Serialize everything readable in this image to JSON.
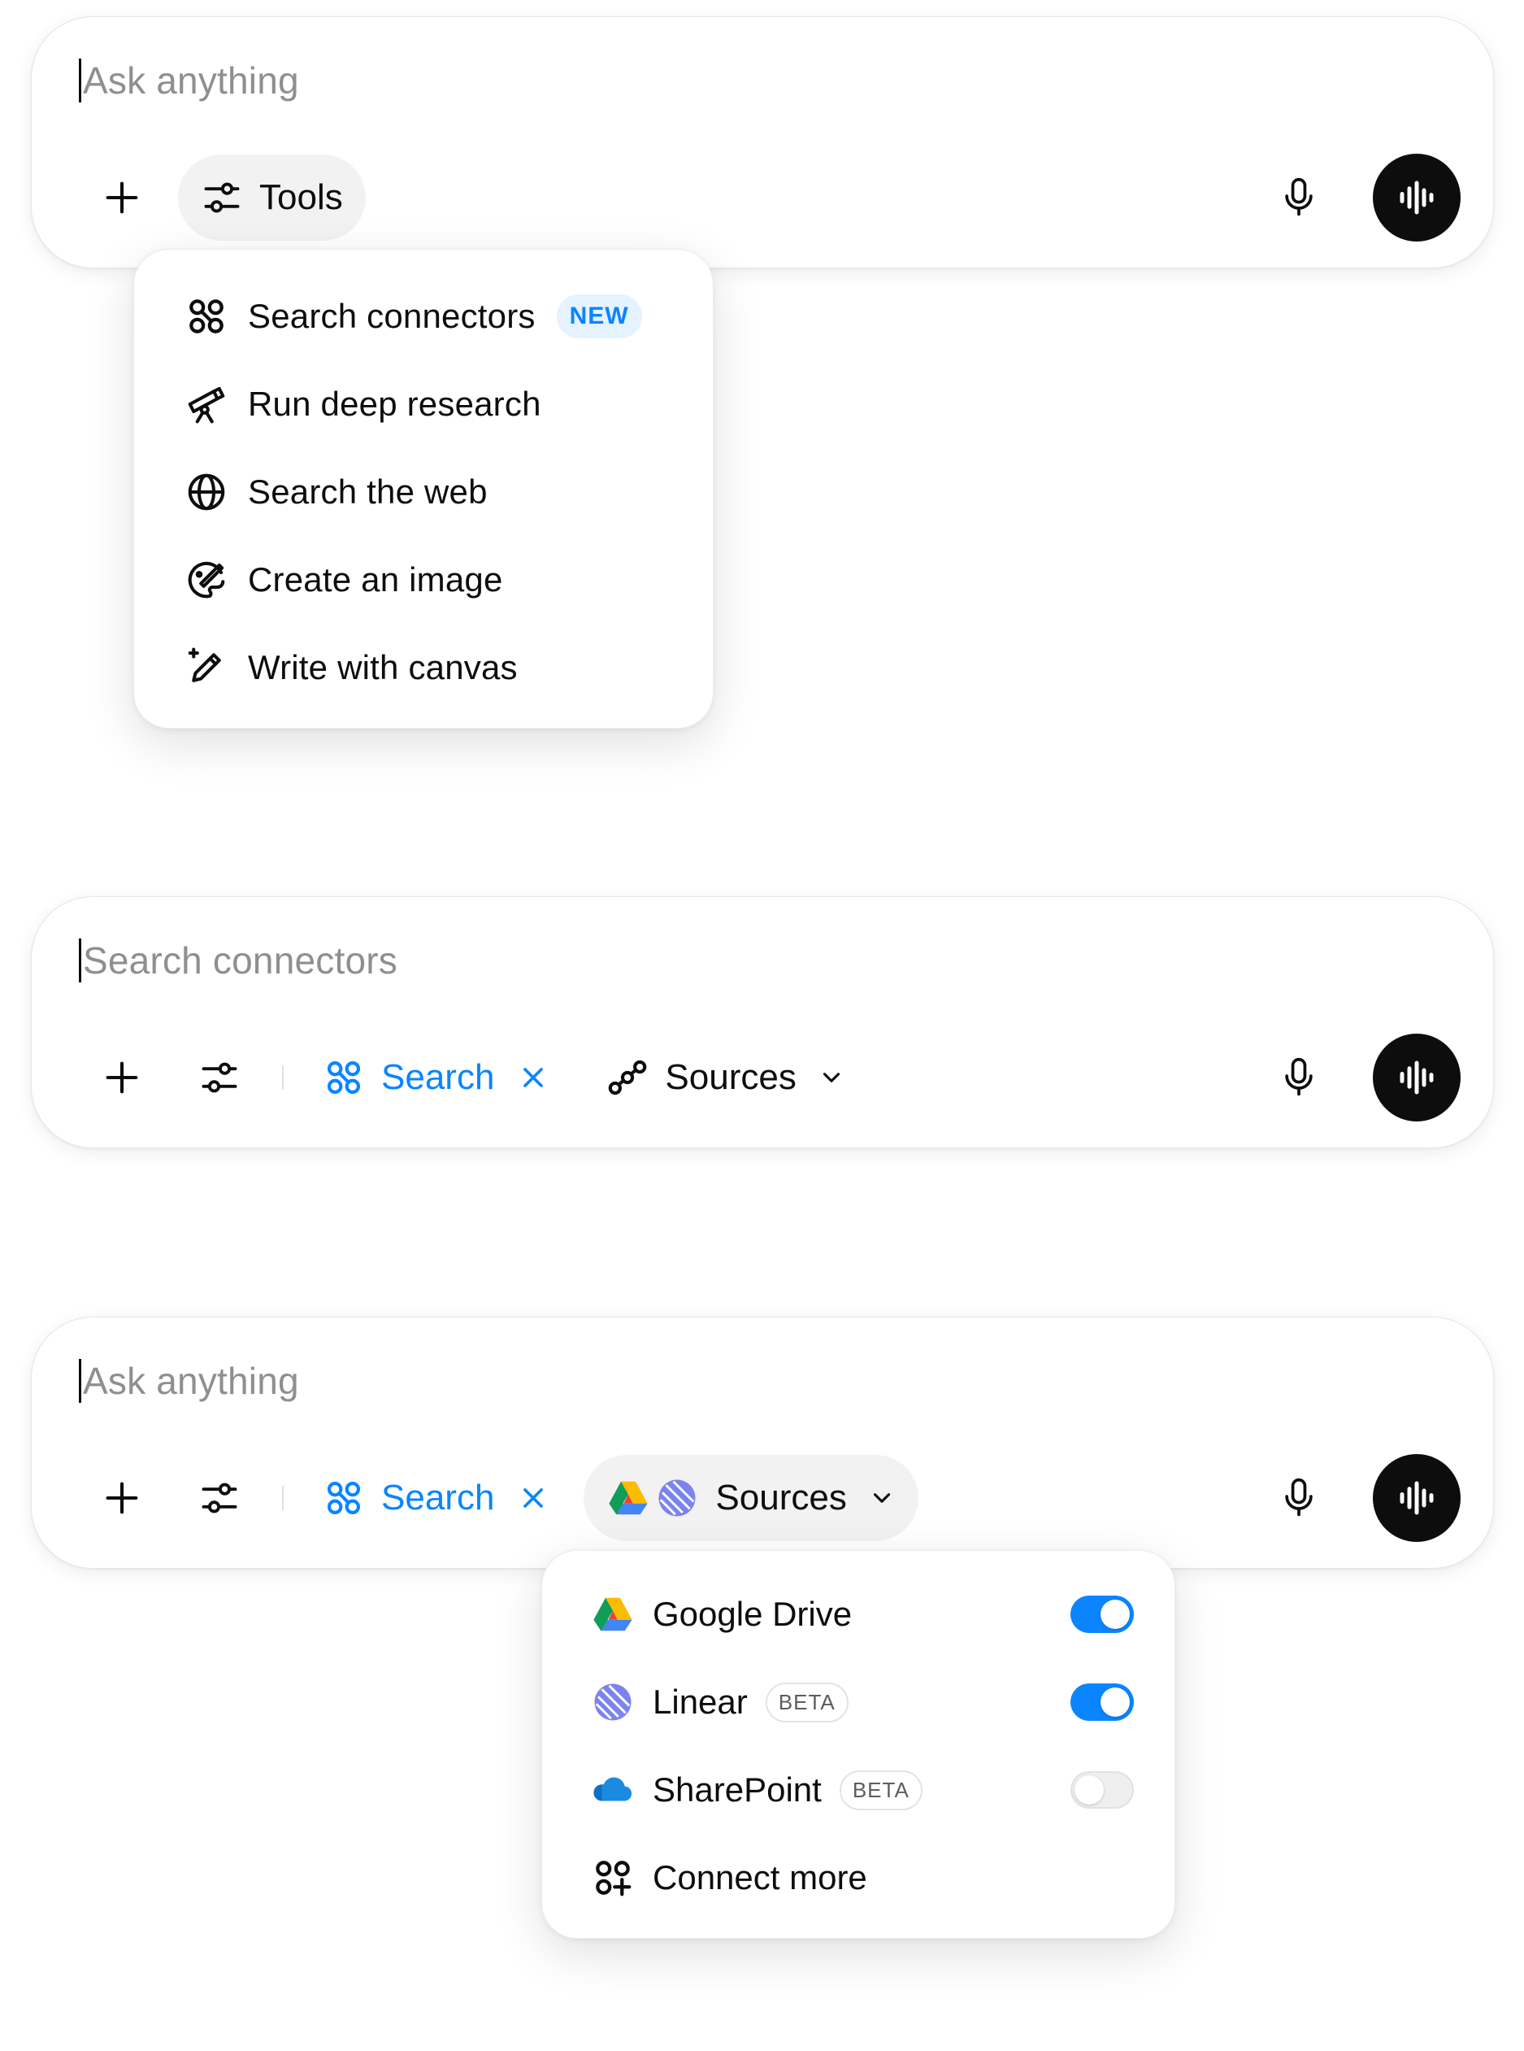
{
  "composer1": {
    "placeholder": "Ask anything",
    "tools_label": "Tools"
  },
  "tools_menu": {
    "items": [
      {
        "label": "Search connectors",
        "badge": "NEW",
        "icon": "connectors-icon"
      },
      {
        "label": "Run deep research",
        "icon": "telescope-icon"
      },
      {
        "label": "Search the web",
        "icon": "globe-icon"
      },
      {
        "label": "Create an image",
        "icon": "palette-icon"
      },
      {
        "label": "Write with canvas",
        "icon": "pen-sparkle-icon"
      }
    ]
  },
  "composer2": {
    "placeholder": "Search connectors",
    "search_label": "Search",
    "sources_label": "Sources"
  },
  "composer3": {
    "placeholder": "Ask anything",
    "search_label": "Search",
    "sources_label": "Sources"
  },
  "sources_menu": {
    "items": [
      {
        "label": "Google Drive",
        "badge": "",
        "enabled": true,
        "icon": "google-drive-icon"
      },
      {
        "label": "Linear",
        "badge": "BETA",
        "enabled": true,
        "icon": "linear-icon"
      },
      {
        "label": "SharePoint",
        "badge": "BETA",
        "enabled": false,
        "icon": "sharepoint-icon"
      }
    ],
    "connect_more": "Connect more"
  },
  "colors": {
    "accent_blue": "#0a85ff",
    "voice_button": "#0d0d0d",
    "placeholder": "#8f8f8f"
  }
}
